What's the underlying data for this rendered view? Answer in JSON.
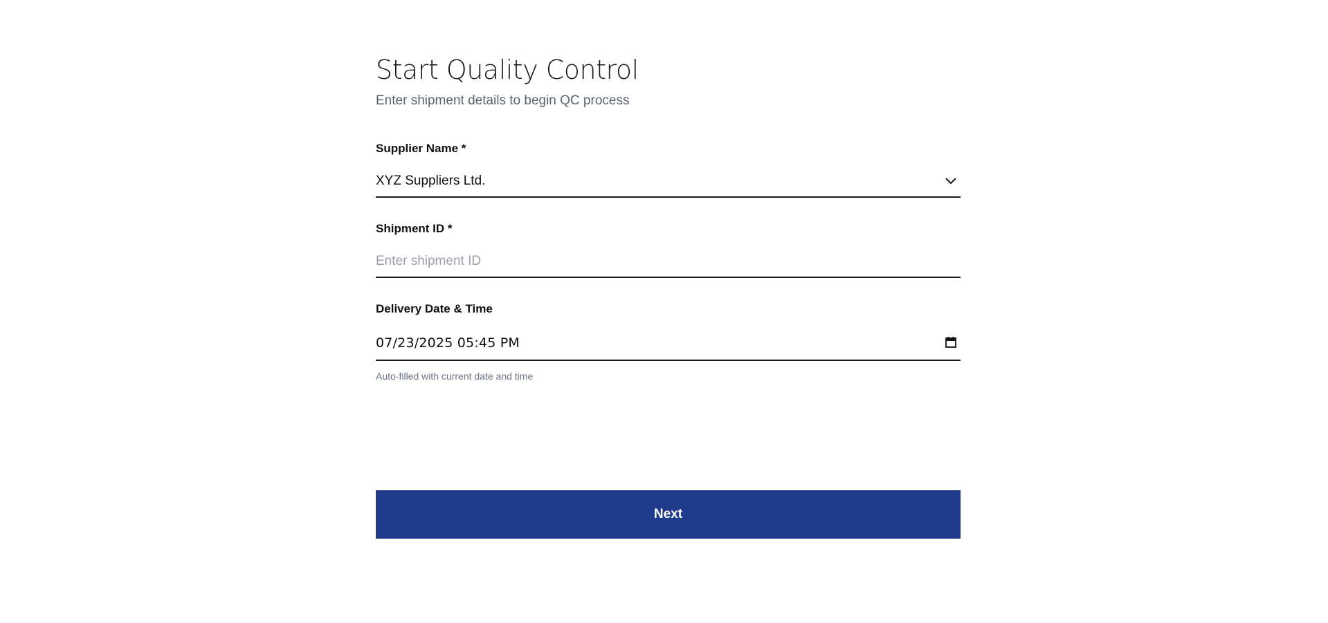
{
  "header": {
    "title": "Start Quality Control",
    "subtitle": "Enter shipment details to begin QC process"
  },
  "fields": {
    "supplier": {
      "label": "Supplier Name *",
      "value": "XYZ Suppliers Ltd.",
      "icon": "chevron-down-icon"
    },
    "shipment_id": {
      "label": "Shipment ID *",
      "value": "",
      "placeholder": "Enter shipment ID"
    },
    "delivery": {
      "label": "Delivery Date & Time",
      "value": "07/23/2025 05:45 PM",
      "icon": "calendar-icon",
      "hint": "Auto-filled with current date and time"
    }
  },
  "actions": {
    "next_label": "Next"
  },
  "colors": {
    "primary": "#1f3a8a",
    "text": "#111111",
    "muted": "#5b6270",
    "placeholder": "#9aa0ab"
  }
}
